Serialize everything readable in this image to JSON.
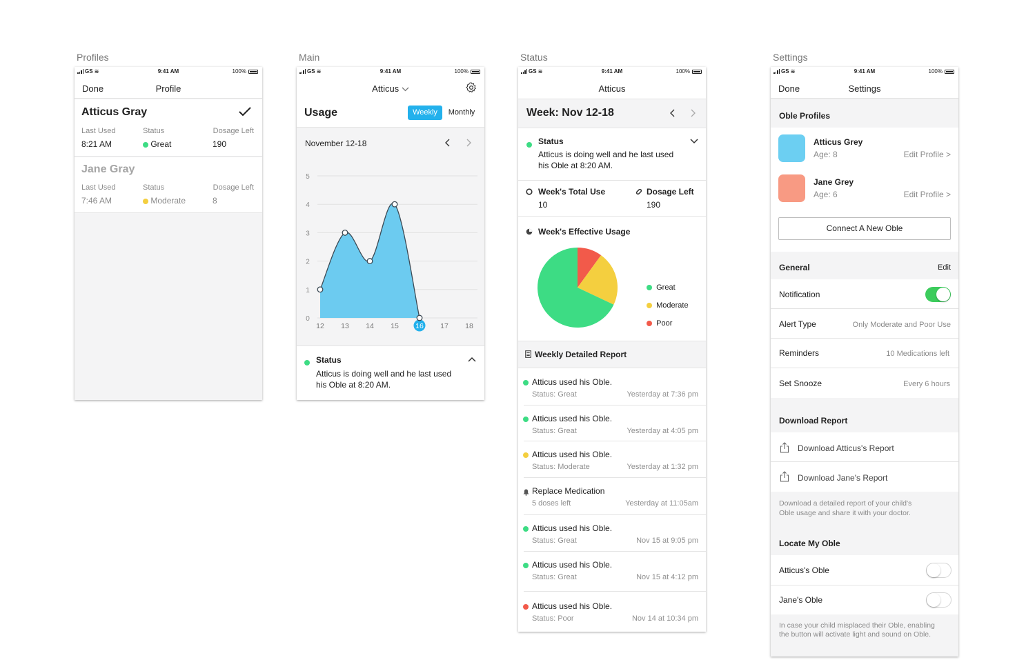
{
  "status_bar": {
    "carrier": "GS",
    "time": "9:41 AM",
    "battery": "100%"
  },
  "profiles_screen": {
    "label": "Profiles",
    "nav": {
      "left": "Done",
      "title": "Profile"
    },
    "profiles": [
      {
        "name": "Atticus Gray",
        "last_used_label": "Last Used",
        "last_used": "8:21 AM",
        "status_label": "Status",
        "status": "Great",
        "dosage_label": "Dosage Left",
        "dosage": "190"
      },
      {
        "name": "Jane Gray",
        "last_used_label": "Last Used",
        "last_used": "7:46 AM",
        "status_label": "Status",
        "status": "Moderate",
        "dosage_label": "Dosage Left",
        "dosage": "8"
      }
    ]
  },
  "main_screen": {
    "label": "Main",
    "nav_title": "Atticus",
    "usage_title": "Usage",
    "seg_weekly": "Weekly",
    "seg_monthly": "Monthly",
    "period": "November 12-18",
    "status_title": "Status",
    "status_text_1": "Atticus is doing well and he last used",
    "status_text_2": "his Oble at 8:20 AM."
  },
  "chart_data": {
    "type": "area",
    "x": [
      12,
      13,
      14,
      15,
      16,
      17,
      18
    ],
    "series": [
      {
        "values": [
          1,
          3,
          2,
          4,
          0
        ]
      }
    ],
    "y_ticks": [
      0,
      1,
      2,
      3,
      4,
      5
    ],
    "ylim": [
      0,
      5
    ],
    "selected_x": 16,
    "color": "#6ccbf0",
    "grid": true
  },
  "status_screen": {
    "label": "Status",
    "nav_title": "Atticus",
    "week_title": "Week: Nov 12-18",
    "status_title": "Status",
    "status_text_1": "Atticus is doing well and he last used",
    "status_text_2": "his Oble at 8:20 AM.",
    "total_use_label": "Week's Total Use",
    "total_use": "10",
    "dosage_label": "Dosage Left",
    "dosage": "190",
    "effective_title": "Week's Effective Usage",
    "pie": [
      {
        "label": "Great",
        "value": 68,
        "color": "#3ddc84"
      },
      {
        "label": "Moderate",
        "value": 22,
        "color": "#f4cf3f"
      },
      {
        "label": "Poor",
        "value": 10,
        "color": "#f25a4a"
      }
    ],
    "report_title": "Weekly Detailed Report",
    "reports": [
      {
        "kind": "dot",
        "color": "#3ddc84",
        "title": "Atticus used his Oble.",
        "sub": "Status: Great",
        "time": "Yesterday at 7:36 pm"
      },
      {
        "kind": "dot",
        "color": "#3ddc84",
        "title": "Atticus used his Oble.",
        "sub": "Status: Great",
        "time": "Yesterday at 4:05 pm"
      },
      {
        "kind": "dot",
        "color": "#f4cf3f",
        "title": "Atticus used his Oble.",
        "sub": "Status: Moderate",
        "time": "Yesterday at 1:32 pm"
      },
      {
        "kind": "bell",
        "color": "#555555",
        "title": "Replace Medication",
        "sub": "5 doses left",
        "time": "Yesterday at 11:05am"
      },
      {
        "kind": "dot",
        "color": "#3ddc84",
        "title": "Atticus used his Oble.",
        "sub": "Status: Great",
        "time": "Nov 15 at 9:05 pm"
      },
      {
        "kind": "dot",
        "color": "#3ddc84",
        "title": "Atticus used his Oble.",
        "sub": "Status: Great",
        "time": "Nov 15 at 4:12 pm"
      },
      {
        "kind": "dot",
        "color": "#f25a4a",
        "title": "Atticus used his Oble.",
        "sub": "Status: Poor",
        "time": "Nov 14 at 10:34 pm"
      }
    ]
  },
  "settings_screen": {
    "label": "Settings",
    "nav": {
      "left": "Done",
      "title": "Settings"
    },
    "profiles_header": "Oble Profiles",
    "profiles": [
      {
        "name": "Atticus Grey",
        "age": "Age: 8",
        "edit": "Edit Profile >",
        "color": "#6ccff2"
      },
      {
        "name": "Jane Grey",
        "age": "Age: 6",
        "edit": "Edit Profile >",
        "color": "#f89a83"
      }
    ],
    "connect_button": "Connect A New Oble",
    "general_header": "General",
    "general_edit": "Edit",
    "notification_label": "Notification",
    "alert_label": "Alert Type",
    "alert_value": "Only Moderate and Poor Use",
    "reminders_label": "Reminders",
    "reminders_value": "10 Medications left",
    "snooze_label": "Set Snooze",
    "snooze_value": "Every 6 hours",
    "download_header": "Download Report",
    "download_atticus": "Download Atticus's Report",
    "download_jane": "Download Jane's Report",
    "download_note_1": "Download a detailed report of your child's",
    "download_note_2": "Oble usage and share it with your doctor.",
    "locate_header": "Locate My Oble",
    "locate_atticus": "Atticus's Oble",
    "locate_jane": "Jane's Oble",
    "locate_note_1": "In case your child misplaced their Oble, enabling",
    "locate_note_2": "the button will activate light and sound on Oble."
  }
}
